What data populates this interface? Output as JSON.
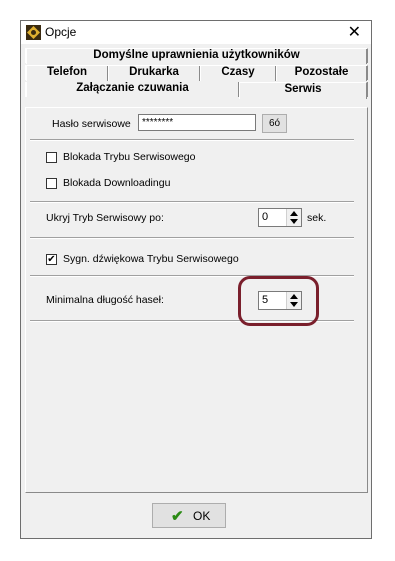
{
  "window": {
    "title": "Opcje",
    "close_glyph": "✕"
  },
  "tabs": {
    "row1": [
      "Domyślne uprawnienia użytkowników"
    ],
    "row2": [
      "Telefon",
      "Drukarka",
      "Czasy",
      "Pozostałe"
    ],
    "row3": [
      "Załączanie czuwania",
      "Serwis"
    ],
    "selected": "Serwis"
  },
  "service": {
    "password_label": "Hasło serwisowe",
    "password_value": "********",
    "password_button": "6ó",
    "lock_mode_label": "Blokada Trybu Serwisowego",
    "lock_mode_checked": false,
    "lock_download_label": "Blokada Downloadingu",
    "lock_download_checked": false,
    "hide_mode_label": "Ukryj Tryb Serwisowy po:",
    "hide_mode_value": "0",
    "hide_mode_unit": "sek.",
    "sound_label": "Sygn. dźwiękowa Trybu Serwisowego",
    "sound_checked": true,
    "sound_check_glyph": "✔",
    "min_len_label": "Minimalna długość haseł:",
    "min_len_value": "5"
  },
  "footer": {
    "ok_label": "OK",
    "ok_icon": "✔"
  },
  "colors": {
    "highlight": "#7a1f2c",
    "ok_check": "#2a8a14"
  }
}
